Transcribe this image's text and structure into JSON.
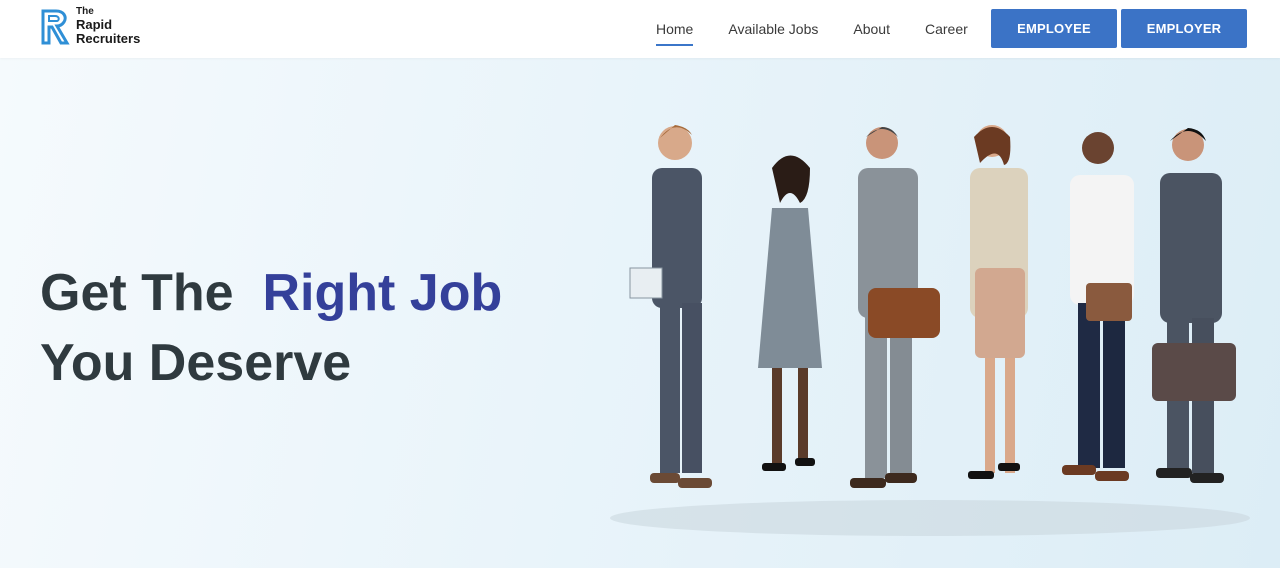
{
  "brand": {
    "line1": "The",
    "line2": "Rapid",
    "line3": "Recruiters",
    "accent_color": "#2f8fd6"
  },
  "nav": {
    "items": [
      {
        "label": "Home",
        "active": true
      },
      {
        "label": "Available Jobs",
        "active": false
      },
      {
        "label": "About",
        "active": false
      },
      {
        "label": "Career",
        "active": false
      }
    ]
  },
  "buttons": {
    "employee": "EMPLOYEE",
    "employer": "EMPLOYER",
    "color": "#3b73c6"
  },
  "hero": {
    "headline_part1": "Get The",
    "headline_accent": "Right Job",
    "headline_line2": "You Deserve",
    "accent_color": "#34409a",
    "image_alt": "group-of-professionals-in-line"
  }
}
